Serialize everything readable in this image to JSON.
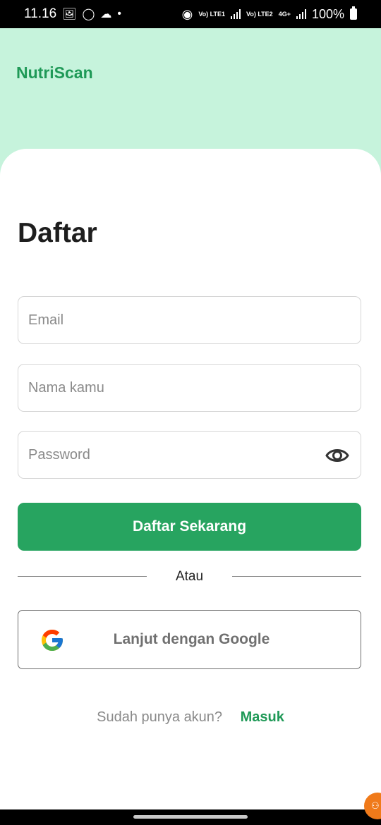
{
  "status_bar": {
    "time": "11.16",
    "network1": "Vo) LTE1",
    "network2": "Vo) LTE2",
    "network3": "4G+",
    "battery": "100%"
  },
  "app": {
    "brand": "NutriScan",
    "title": "Daftar"
  },
  "form": {
    "email_placeholder": "Email",
    "name_placeholder": "Nama kamu",
    "password_placeholder": "Password",
    "submit_label": "Daftar Sekarang",
    "divider_text": "Atau",
    "google_label": "Lanjut dengan Google"
  },
  "footer": {
    "question": "Sudah punya akun?",
    "login_link": "Masuk"
  },
  "colors": {
    "header_bg": "#c6f3dc",
    "brand": "#1f9957",
    "primary_button": "#27a460"
  },
  "icons": {
    "password_toggle": "eye-icon",
    "google": "google-logo-icon"
  }
}
